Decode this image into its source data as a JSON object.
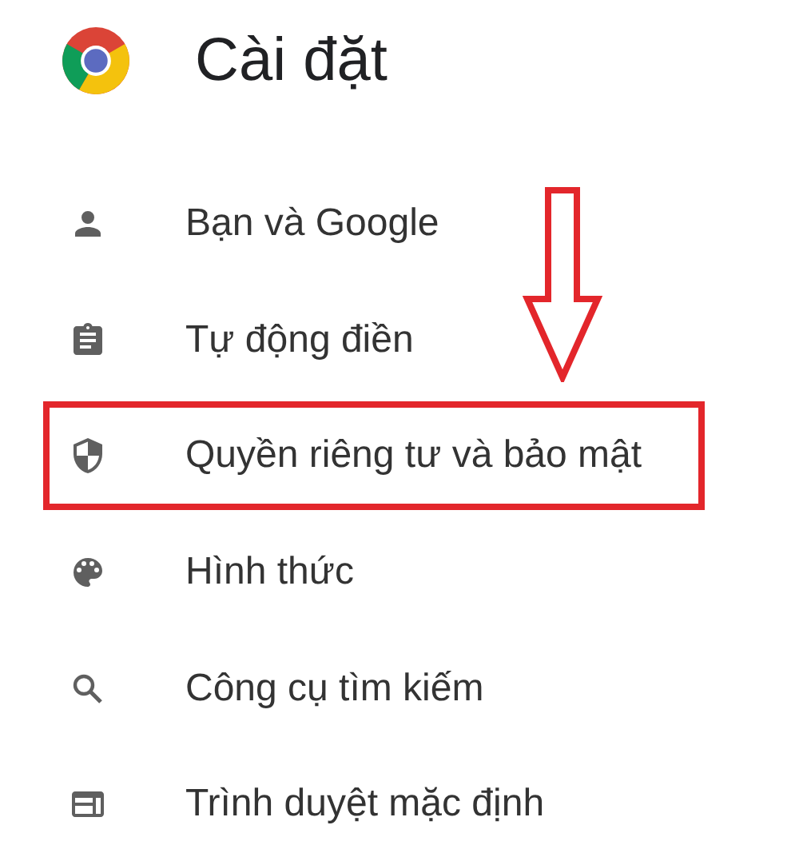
{
  "header": {
    "title": "Cài đặt"
  },
  "menu": [
    {
      "label": "Bạn và Google",
      "kind": "person",
      "highlighted": false
    },
    {
      "label": "Tự động điền",
      "kind": "clipboard",
      "highlighted": false
    },
    {
      "label": "Quyền riêng tư và bảo mật",
      "kind": "shield",
      "highlighted": true
    },
    {
      "label": "Hình thức",
      "kind": "palette",
      "highlighted": false
    },
    {
      "label": "Công cụ tìm kiếm",
      "kind": "search",
      "highlighted": false
    },
    {
      "label": "Trình duyệt mặc định",
      "kind": "browser",
      "highlighted": false
    }
  ]
}
